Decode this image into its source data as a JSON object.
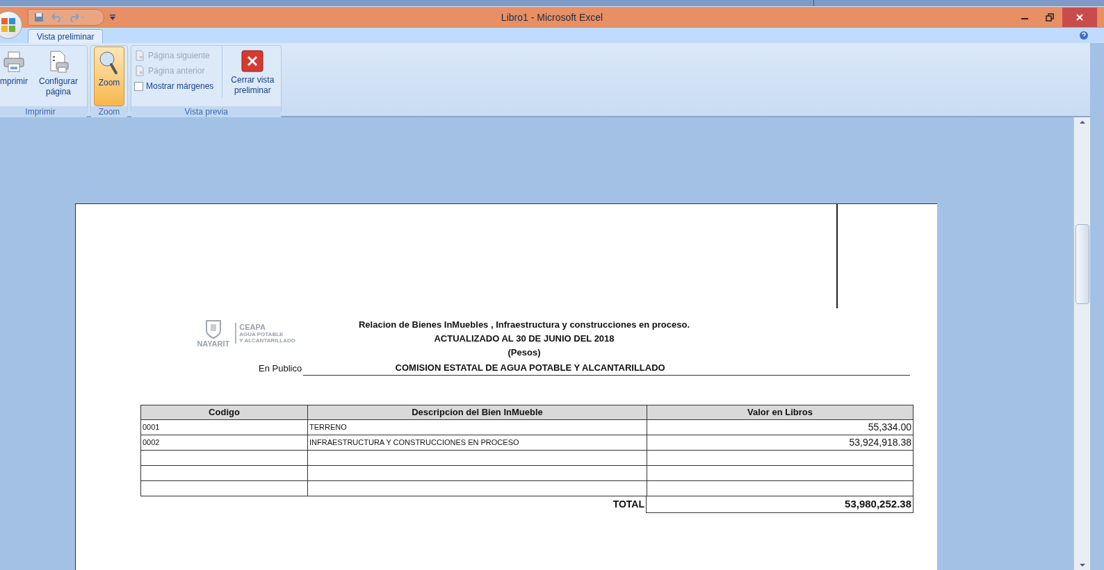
{
  "window": {
    "title": "Libro1 - Microsoft Excel"
  },
  "tabs": [
    {
      "label": "Vista preliminar",
      "selected": true
    }
  ],
  "ribbon": {
    "groups": [
      {
        "label": "Imprimir",
        "items": [
          {
            "kind": "large",
            "label": "mprimir",
            "selected": false,
            "disabled": false
          },
          {
            "kind": "large",
            "label": "Configurar página",
            "selected": false,
            "disabled": false
          }
        ]
      },
      {
        "label": "Zoom",
        "items": [
          {
            "kind": "large",
            "label": "Zoom",
            "selected": true,
            "disabled": false
          }
        ]
      },
      {
        "label": "Vista previa",
        "items": [
          {
            "kind": "small",
            "label": "Página siguiente",
            "disabled": true
          },
          {
            "kind": "small",
            "label": "Página anterior",
            "disabled": true
          },
          {
            "kind": "check",
            "label": "Mostrar márgenes",
            "checked": false
          },
          {
            "kind": "large",
            "label": "Cerrar vista preliminar",
            "selected": false,
            "disabled": false
          }
        ]
      }
    ]
  },
  "page": {
    "logo": {
      "left": "NAYARIT",
      "right_title": "CEAPA",
      "right_lines": [
        "AGUA POTABLE",
        "Y ALCANTARILLADO"
      ]
    },
    "title_lines": [
      "Relacion de Bienes InMuebles , Infraestructura y construcciones en proceso.",
      "ACTUALIZADO AL 30 DE JUNIO DEL 2018",
      "(Pesos)"
    ],
    "entity_label": "En Publico",
    "entity_value": "COMISION ESTATAL DE AGUA POTABLE Y ALCANTARILLADO",
    "table": {
      "columns": [
        "Codigo",
        "Descripcion del Bien InMueble",
        "Valor en Libros"
      ],
      "rows": [
        [
          "0001",
          "TERRENO",
          "55,334.00"
        ],
        [
          "0002",
          "INFRAESTRUCTURA Y CONSTRUCCIONES EN PROCESO",
          "53,924,918.38"
        ],
        [
          "",
          "",
          ""
        ],
        [
          "",
          "",
          ""
        ],
        [
          "",
          "",
          ""
        ]
      ],
      "total_label": "TOTAL",
      "total_value": "53,980,252.38"
    }
  }
}
